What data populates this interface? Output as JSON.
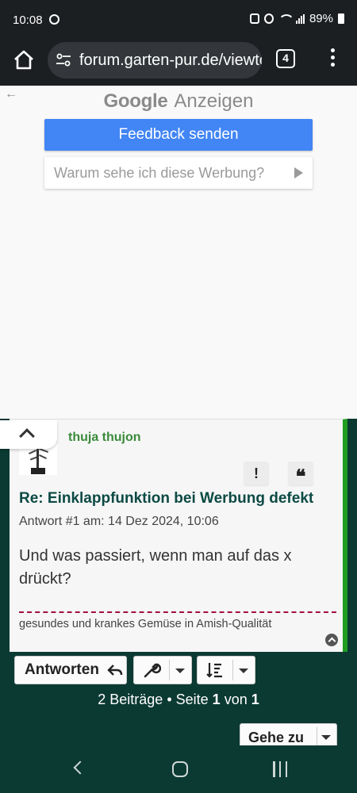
{
  "status_bar": {
    "time": "10:08",
    "battery": "89%"
  },
  "browser": {
    "url": "forum.garten-pur.de/viewtopic",
    "tab_count": "4"
  },
  "ad": {
    "brand_google": "Google",
    "brand_label": "Anzeigen",
    "feedback_button": "Feedback senden",
    "why_button": "Warum sehe ich diese Werbung?"
  },
  "post": {
    "author": "thuja thujon",
    "report_label": "!",
    "quote_label": "❝",
    "title": "Re: Einklappfunktion bei Werbung defekt",
    "meta": "Antwort #1 am: 14 Dez 2024, 10:06",
    "body": "Und was passiert, wenn man auf das x drückt?",
    "signature": "gesundes und krankes Gemüse in Amish-Qualität"
  },
  "actions": {
    "reply_label": "Antworten",
    "goto_label": "Gehe zu"
  },
  "pagination": {
    "posts": "2 Beiträge",
    "sep": " • Seite ",
    "current": "1",
    "of": " von ",
    "total": "1"
  },
  "colors": {
    "forum_bg": "#0b3a33",
    "accent_green": "#1f9d1f",
    "title_color": "#0c4a44",
    "google_blue": "#4285f4",
    "signature_rule": "#a0123c"
  }
}
